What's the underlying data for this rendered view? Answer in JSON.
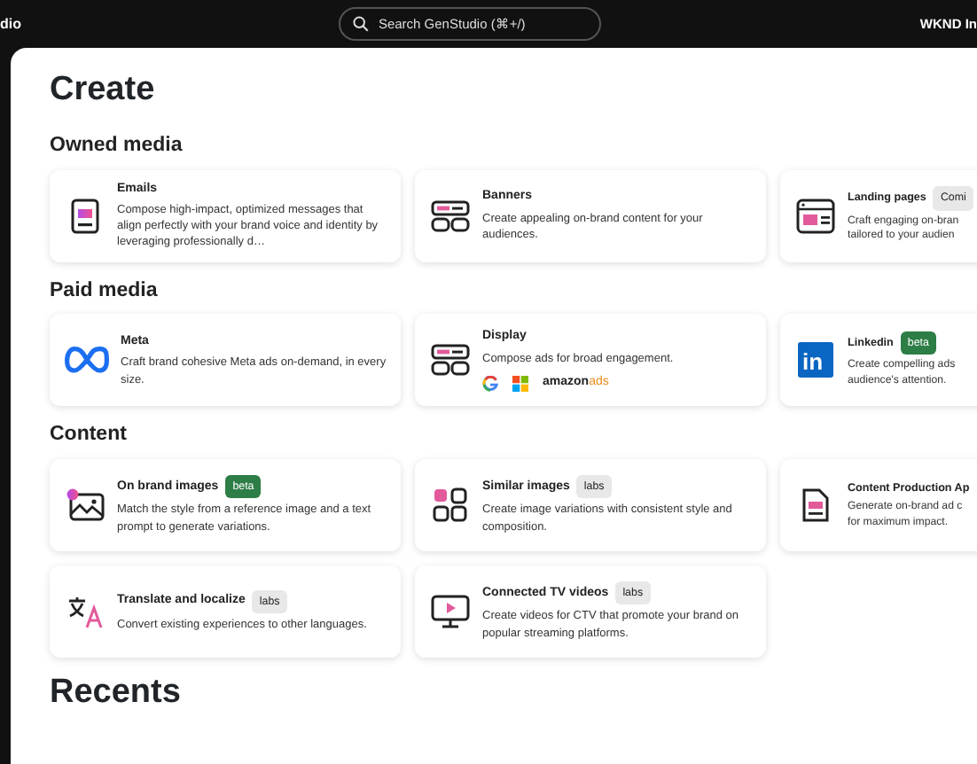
{
  "top_bar": {
    "app_name": "dio",
    "search": {
      "placeholder": "Search GenStudio (⌘+/)"
    },
    "org_name": "WKND In"
  },
  "page_title": "Create",
  "sections": [
    {
      "title": "Owned media",
      "cards": [
        {
          "kind": "email",
          "title": "Emails",
          "description": "Compose high-impact, optimized messages that align perfectly with your brand voice and identity by leveraging professionally d…"
        },
        {
          "kind": "banner",
          "title": "Banners",
          "description": "Create appealing on-brand content for your audiences."
        },
        {
          "kind": "landing",
          "title": "Landing pages",
          "badge": {
            "text": "Comi",
            "kind": "gray"
          },
          "description": "Craft engaging on-bran\ntailored to your audien"
        }
      ]
    },
    {
      "title": "Paid media",
      "cards": [
        {
          "kind": "meta",
          "title": "Meta",
          "description": "Craft brand cohesive Meta ads on-demand, in every size."
        },
        {
          "kind": "banner",
          "title": "Display",
          "description": "Compose ads for broad engagement.",
          "partner_logos": [
            {
              "kind": "google"
            },
            {
              "kind": "microsoft"
            },
            {
              "kind": "amazon",
              "text": "amazon",
              "suffix": "ads"
            }
          ]
        },
        {
          "kind": "linkedin",
          "logo_text": "in",
          "title": "Linkedin",
          "badge": {
            "text": "beta",
            "kind": "green"
          },
          "description": "Create compelling ads\naudience's attention."
        }
      ]
    },
    {
      "title": "Content",
      "cards": [
        {
          "kind": "image",
          "title": "On brand images",
          "badge": {
            "text": "beta",
            "kind": "green"
          },
          "description": "Match the style from a reference image and a text prompt to generate variations."
        },
        {
          "kind": "grid",
          "title": "Similar images",
          "badge": {
            "text": "labs",
            "kind": "gray"
          },
          "description": "Create image variations with consistent style and composition."
        },
        {
          "kind": "document",
          "title": "Content Production Ap",
          "description": "Generate on-brand ad c\nfor maximum impact."
        },
        {
          "kind": "translate",
          "title": "Translate and localize",
          "badge": {
            "text": "labs",
            "kind": "gray"
          },
          "description": "Convert existing experiences to other languages."
        },
        {
          "kind": "tv",
          "title": "Connected TV videos",
          "badge": {
            "text": "labs",
            "kind": "gray"
          },
          "description": "Create videos for CTV that promote your brand on popular streaming platforms."
        }
      ]
    }
  ],
  "recents_title": "Recents"
}
